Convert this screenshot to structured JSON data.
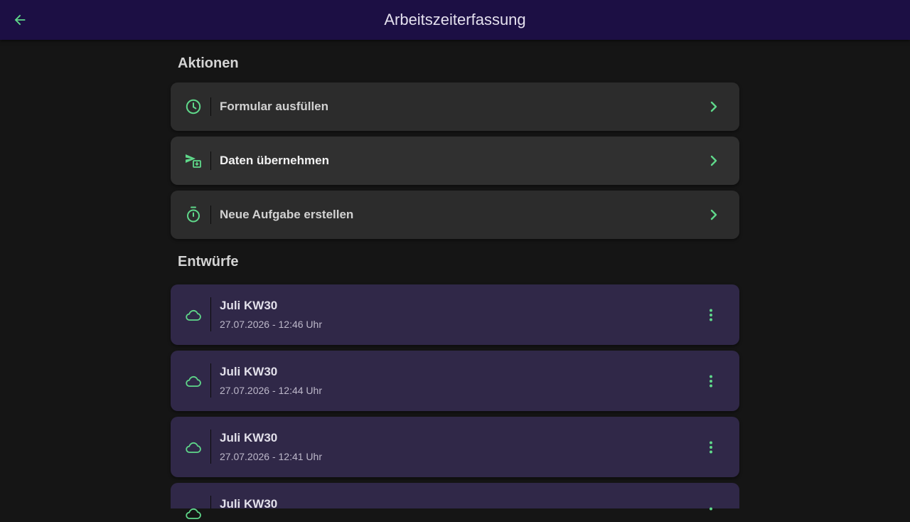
{
  "appbar": {
    "title": "Arbeitszeiterfassung",
    "back_icon": "arrow-back-icon"
  },
  "sections": {
    "actions_title": "Aktionen",
    "drafts_title": "Entwürfe"
  },
  "actions": [
    {
      "label": "Formular ausfüllen",
      "icon": "clock-icon"
    },
    {
      "label": "Daten übernehmen",
      "icon": "import-data-icon"
    },
    {
      "label": "Neue Aufgabe erstellen",
      "icon": "stopwatch-icon"
    }
  ],
  "drafts": [
    {
      "title": "Juli KW30",
      "subtitle": "27.07.2026 - 12:46 Uhr",
      "icon": "cloud-icon"
    },
    {
      "title": "Juli KW30",
      "subtitle": "27.07.2026 - 12:44 Uhr",
      "icon": "cloud-icon"
    },
    {
      "title": "Juli KW30",
      "subtitle": "27.07.2026 - 12:41 Uhr",
      "icon": "cloud-icon"
    },
    {
      "title": "Juli KW30",
      "subtitle": "",
      "icon": "cloud-icon"
    }
  ],
  "colors": {
    "appbar": "#1c0f44",
    "background": "#151515",
    "action_card": "#2c2c2c",
    "draft_card": "#302848",
    "accent_green": "#5fd88a"
  }
}
